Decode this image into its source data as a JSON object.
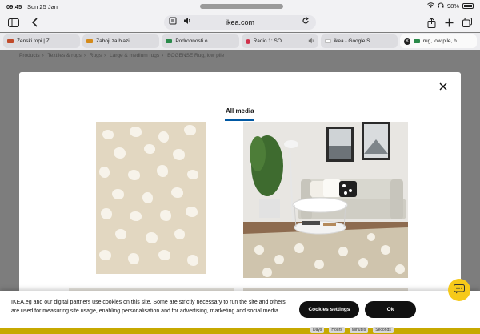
{
  "status": {
    "time": "09:45",
    "date": "Sun 25 Jan",
    "battery": "98%"
  },
  "browser": {
    "url": "ikea.com",
    "tabs": [
      {
        "label": "Ženski topi | Z...",
        "color": "#c04a2a",
        "active": false
      },
      {
        "label": "Zaboji za blazi...",
        "color": "#d48a1a",
        "active": false
      },
      {
        "label": "Podrobnosti o ...",
        "color": "#2a8a4a",
        "active": false
      },
      {
        "label": "Radio 1: SO...",
        "color": "#d0304a",
        "active": false,
        "sound": true
      },
      {
        "label": "ikea - Google S...",
        "color": "#ffffff",
        "active": false
      },
      {
        "label": "rug, low pile, b...",
        "color": "#2a8a4a",
        "active": true
      }
    ]
  },
  "breadcrumb": [
    "Products",
    "Textiles & rugs",
    "Rugs",
    "Large & medium rugs",
    "BOGENSE Rug, low pile"
  ],
  "modal": {
    "tab_title": "All media",
    "close_label": "×"
  },
  "cookie": {
    "text": "IKEA.eg and our digital partners use cookies on this site. Some are strictly necessary to run the site and others are used for measuring site usage, enabling personalisation and for advertising, marketing and social media.",
    "settings_label": "Cookies settings",
    "ok_label": "Ok"
  },
  "countdown_labels": [
    "Days",
    "Hours",
    "Minutes",
    "Seconds"
  ],
  "colors": {
    "accent": "#0058a3",
    "chat": "#f6c919",
    "rug": "#e2d7c1"
  }
}
